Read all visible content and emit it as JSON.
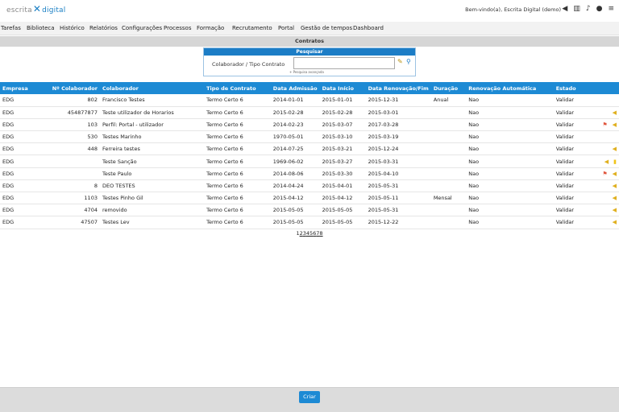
{
  "brand": {
    "part1": "escrita",
    "part2": "digital"
  },
  "header": {
    "welcome": "Bem-vindo(a), Escrita Digital (demo)",
    "icons": [
      "arrow-left-icon",
      "building-icon",
      "bell-icon",
      "user-icon",
      "menu-icon"
    ]
  },
  "menu": [
    "Tarefas",
    "Biblioteca",
    "Histórico",
    "Relatórios",
    "Configurações",
    "Processos",
    "Formação",
    "Recrutamento",
    "Portal",
    "Gestão de tempos",
    "Dashboard"
  ],
  "section_title": "Contratos",
  "search": {
    "header": "Pesquisar",
    "label": "Colaborador / Tipo Contrato",
    "value": "",
    "advanced": "+ Pesquisa avançada"
  },
  "table": {
    "headers": [
      "Empresa",
      "Nº Colaborador",
      "Colaborador",
      "Tipo de Contrato",
      "Data Admissão",
      "Data Início",
      "Data Renovação/Fim",
      "Duração",
      "Renovação Automática",
      "Estado"
    ],
    "rows": [
      {
        "empresa": "EDG",
        "num": "802",
        "colaborador": "Francisco Testes",
        "tipo": "Termo Certo 6",
        "admissao": "2014-01-01",
        "inicio": "2015-01-01",
        "renovacao": "2015-12-31",
        "duracao": "Anual",
        "auto": "Nao",
        "estado": "Validar",
        "icons": []
      },
      {
        "empresa": "EDG",
        "num": "454877877",
        "colaborador": "Teste utilizador de Horarios",
        "tipo": "Termo Certo 6",
        "admissao": "2015-02-28",
        "inicio": "2015-02-28",
        "renovacao": "2015-03-01",
        "duracao": "",
        "auto": "Nao",
        "estado": "Validar",
        "icons": [
          "bell"
        ]
      },
      {
        "empresa": "EDG",
        "num": "103",
        "colaborador": "Perfil: Portal - utilizador",
        "tipo": "Termo Certo 6",
        "admissao": "2014-02-23",
        "inicio": "2015-03-07",
        "renovacao": "2017-03-28",
        "duracao": "",
        "auto": "Nao",
        "estado": "Validar",
        "icons": [
          "flag",
          "bell"
        ]
      },
      {
        "empresa": "EDG",
        "num": "530",
        "colaborador": "Testes Marinho",
        "tipo": "Termo Certo 6",
        "admissao": "1970-05-01",
        "inicio": "2015-03-10",
        "renovacao": "2015-03-19",
        "duracao": "",
        "auto": "Nao",
        "estado": "Validar",
        "icons": []
      },
      {
        "empresa": "EDG",
        "num": "448",
        "colaborador": "Ferreira testes",
        "tipo": "Termo Certo 6",
        "admissao": "2014-07-25",
        "inicio": "2015-03-21",
        "renovacao": "2015-12-24",
        "duracao": "",
        "auto": "Nao",
        "estado": "Validar",
        "icons": [
          "bell"
        ]
      },
      {
        "empresa": "EDG",
        "num": "",
        "colaborador": "Teste Sanção",
        "tipo": "Termo Certo 6",
        "admissao": "1969-06-02",
        "inicio": "2015-03-27",
        "renovacao": "2015-03-31",
        "duracao": "",
        "auto": "Nao",
        "estado": "Validar",
        "icons": [
          "bell",
          "doc"
        ]
      },
      {
        "empresa": "EDG",
        "num": "",
        "colaborador": "Teste Paulo",
        "tipo": "Termo Certo 6",
        "admissao": "2014-08-06",
        "inicio": "2015-03-30",
        "renovacao": "2015-04-10",
        "duracao": "",
        "auto": "Nao",
        "estado": "Validar",
        "icons": [
          "flag",
          "bell"
        ]
      },
      {
        "empresa": "EDG",
        "num": "8",
        "colaborador": "DEO TESTES",
        "tipo": "Termo Certo 6",
        "admissao": "2014-04-24",
        "inicio": "2015-04-01",
        "renovacao": "2015-05-31",
        "duracao": "",
        "auto": "Nao",
        "estado": "Validar",
        "icons": [
          "bell"
        ]
      },
      {
        "empresa": "EDG",
        "num": "1103",
        "colaborador": "Testes Pinho Gil",
        "tipo": "Termo Certo 6",
        "admissao": "2015-04-12",
        "inicio": "2015-04-12",
        "renovacao": "2015-05-11",
        "duracao": "Mensal",
        "auto": "Nao",
        "estado": "Validar",
        "icons": [
          "bell"
        ]
      },
      {
        "empresa": "EDG",
        "num": "4704",
        "colaborador": "removido",
        "tipo": "Termo Certo 6",
        "admissao": "2015-05-05",
        "inicio": "2015-05-05",
        "renovacao": "2015-05-31",
        "duracao": "",
        "auto": "Nao",
        "estado": "Validar",
        "icons": [
          "bell"
        ]
      },
      {
        "empresa": "EDG",
        "num": "47507",
        "colaborador": "Testes Lev",
        "tipo": "Termo Certo 6",
        "admissao": "2015-05-05",
        "inicio": "2015-05-05",
        "renovacao": "2015-12-22",
        "duracao": "",
        "auto": "Nao",
        "estado": "Validar",
        "icons": [
          "bell"
        ]
      }
    ]
  },
  "pagination": [
    "1",
    "2",
    "3",
    "4",
    "5",
    "6",
    "7",
    "8"
  ],
  "footer": {
    "create_label": "Criar"
  },
  "colors": {
    "accent": "#1d8ad4",
    "bell": "#e0b020",
    "flag": "#e0543c"
  }
}
